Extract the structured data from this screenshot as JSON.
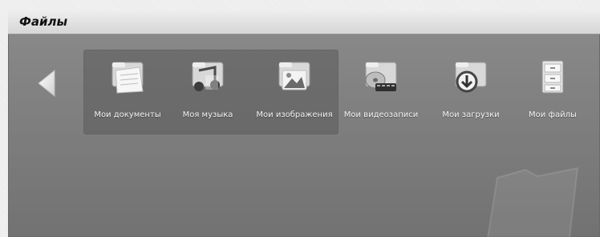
{
  "window": {
    "title": "Файлы"
  },
  "nav": {
    "back_icon": "left-triangle-icon"
  },
  "items": [
    {
      "label": "Мои документы",
      "icon": "documents-folder-icon"
    },
    {
      "label": "Моя музыка",
      "icon": "music-folder-icon"
    },
    {
      "label": "Мои изображения",
      "icon": "images-folder-icon"
    },
    {
      "label": "Мои видеозаписи",
      "icon": "video-folder-icon"
    },
    {
      "label": "Мои загрузки",
      "icon": "downloads-folder-icon"
    },
    {
      "label": "Мои файлы",
      "icon": "file-cabinet-icon"
    }
  ],
  "selection": {
    "selected_items": [
      "Мои документы",
      "Моя музыка",
      "Мои изображения"
    ]
  }
}
